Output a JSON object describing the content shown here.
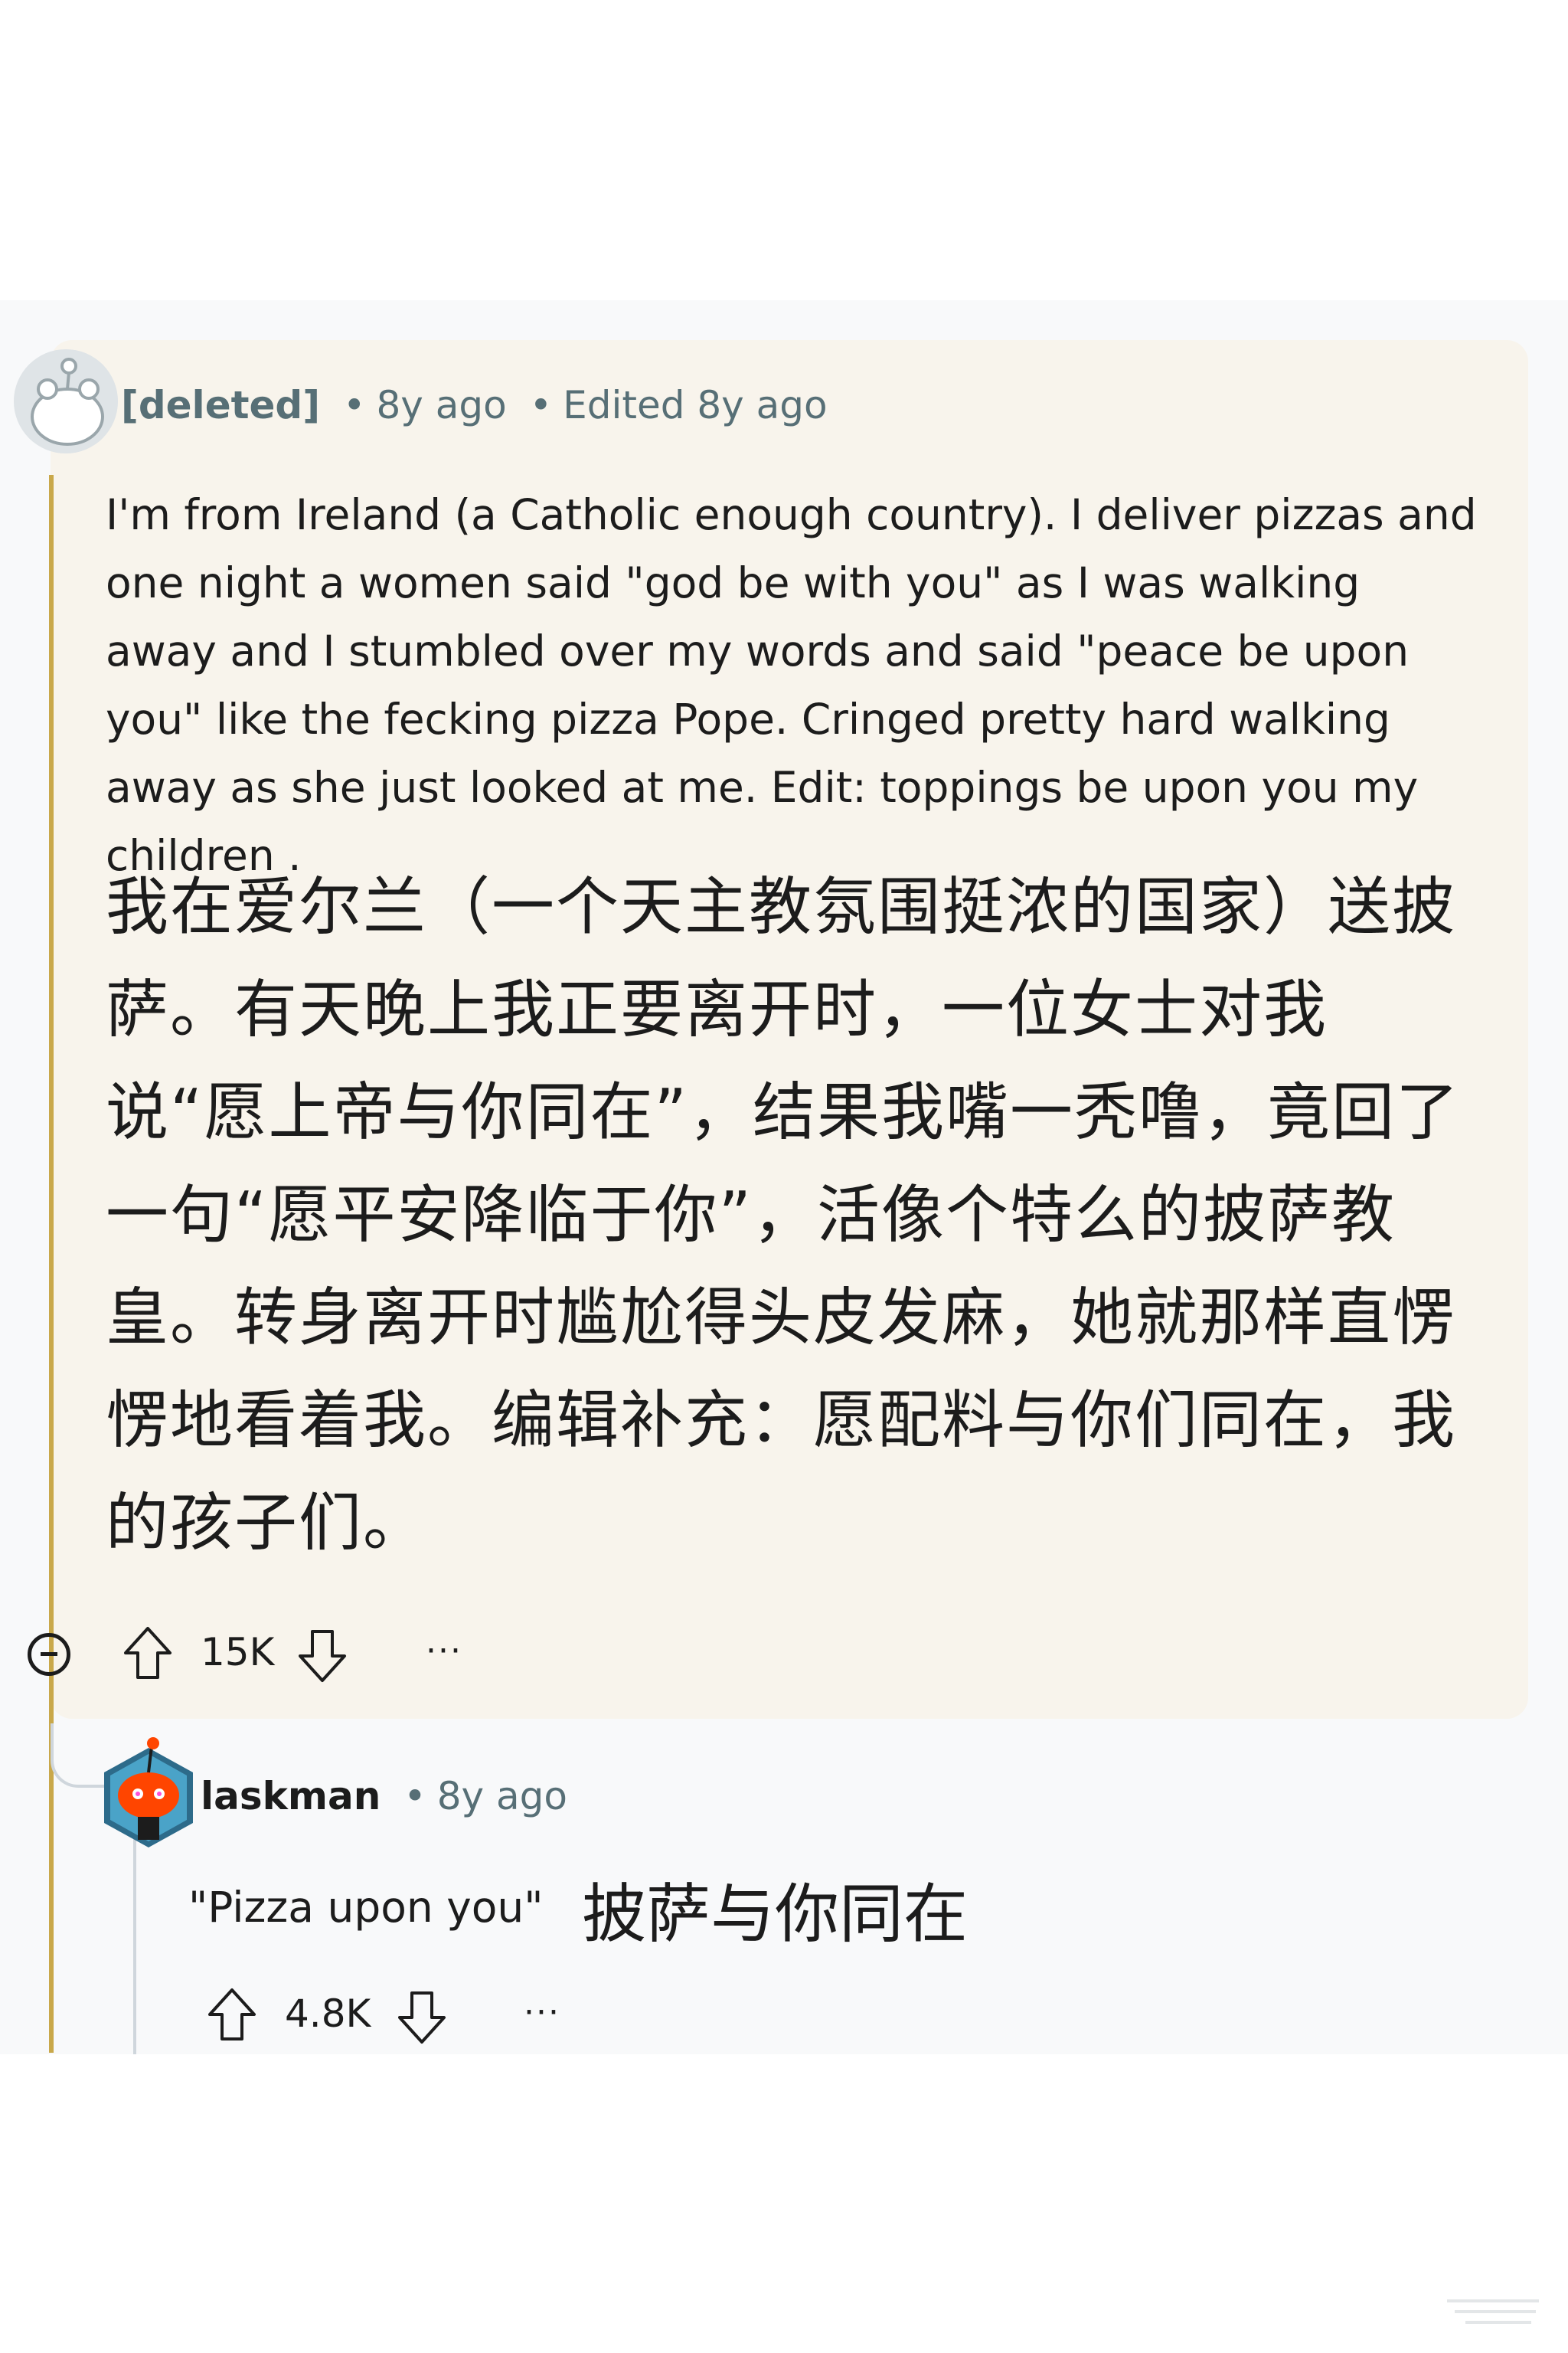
{
  "comment": {
    "author": "[deleted]",
    "time": "8y ago",
    "edited": "Edited 8y ago",
    "body_en": "I'm from Ireland (a Catholic enough country). I deliver pizzas and one night a women said \"god be with you\" as I was walking away and I stumbled over my words and said \"peace be upon you\" like the fecking pizza Pope. Cringed pretty hard walking away as she just looked at me. Edit: toppings be upon you my children .",
    "body_zh": "我在爱尔兰（一个天主教氛围挺浓的国家）送披萨。有天晚上我正要离开时，一位女士对我说“愿上帝与你同在”，结果我嘴一秃噜，竟回了一句“愿平安降临于你”，活像个特么的披萨教皇。转身离开时尴尬得头皮发麻，她就那样直愣愣地看着我。编辑补充：愿配料与你们同在，我的孩子们。",
    "score": "15K",
    "more": "···",
    "dot": "•"
  },
  "reply": {
    "author": "laskman",
    "time": "8y ago",
    "body_en": "\"Pizza upon you\"",
    "body_zh": "披萨与你同在",
    "score": "4.8K",
    "more": "···",
    "dot": "•"
  },
  "colors": {
    "card_bg": "#f8f4ec",
    "rail_highlight": "#c9a84a",
    "meta_text": "#576f76",
    "reply_avatar_orange": "#ff4500"
  }
}
